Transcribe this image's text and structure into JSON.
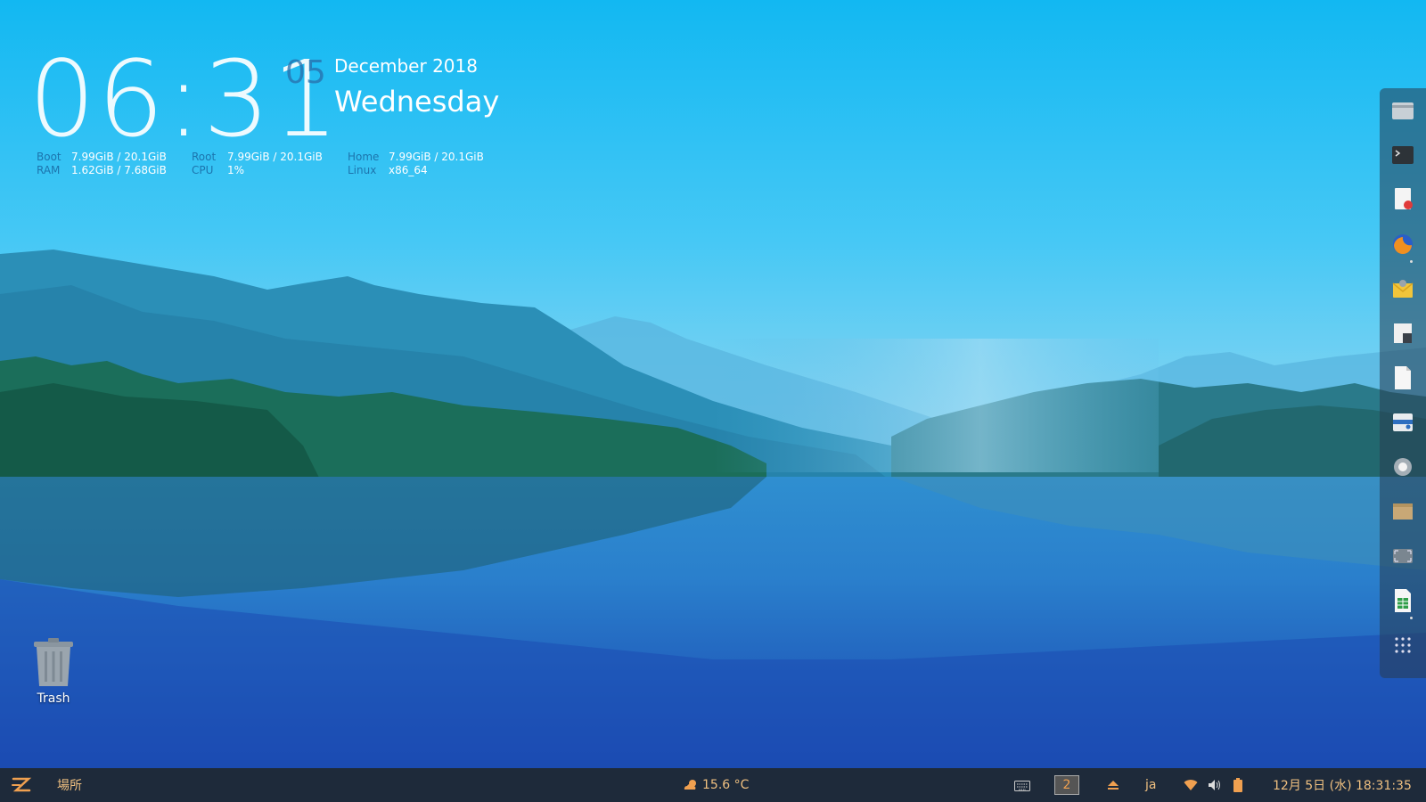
{
  "conky": {
    "time": "06:31",
    "day": "05",
    "month_year": "December 2018",
    "weekday": "Wednesday",
    "stats": [
      {
        "label": "Boot",
        "value": "7.99GiB / 20.1GiB"
      },
      {
        "label": "RAM",
        "value": "1.62GiB / 7.68GiB"
      },
      {
        "label": "Root",
        "value": "7.99GiB / 20.1GiB"
      },
      {
        "label": "CPU",
        "value": "1%"
      },
      {
        "label": "Home",
        "value": "7.99GiB / 20.1GiB"
      },
      {
        "label": "Linux",
        "value": "x86_64"
      }
    ]
  },
  "desktop": {
    "trash_label": "Trash"
  },
  "dock": {
    "items": [
      {
        "name": "files-icon"
      },
      {
        "name": "terminal-icon"
      },
      {
        "name": "document-viewer-icon"
      },
      {
        "name": "firefox-icon"
      },
      {
        "name": "mail-icon"
      },
      {
        "name": "calendar-icon"
      },
      {
        "name": "text-editor-icon"
      },
      {
        "name": "software-center-icon"
      },
      {
        "name": "settings-icon"
      },
      {
        "name": "archive-icon"
      },
      {
        "name": "screenshot-icon"
      },
      {
        "name": "spreadsheet-icon"
      },
      {
        "name": "app-grid-icon"
      }
    ]
  },
  "panel": {
    "places_label": "場所",
    "weather": "15.6 °C",
    "workspace": "2",
    "input_method": "ja",
    "clock": "12月 5日 (水) 18:31:35"
  },
  "colors": {
    "accent": "#f0a050",
    "panel_bg": "#1e2a3a",
    "dock_bg": "#3c4a5a"
  }
}
